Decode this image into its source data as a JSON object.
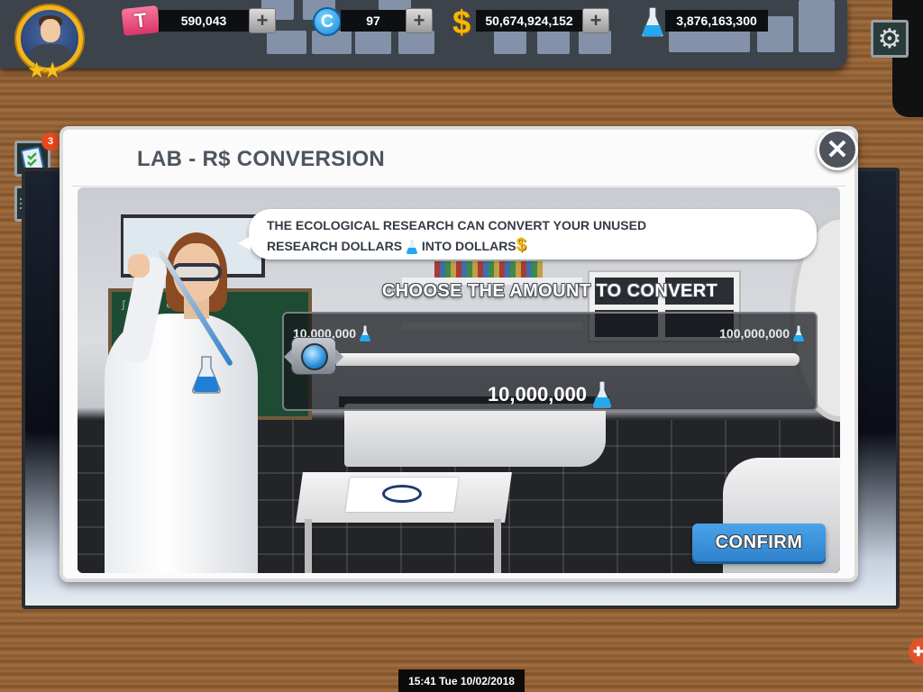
{
  "hud": {
    "player": {
      "stars": 2
    },
    "resources": [
      {
        "name": "tickets",
        "icon": "ticket-icon",
        "value": "590,043",
        "has_plus": true,
        "plus_label": "+"
      },
      {
        "name": "coins",
        "icon": "coin-icon",
        "icon_glyph": "C",
        "value": "97",
        "has_plus": true,
        "plus_label": "+"
      },
      {
        "name": "dollars",
        "icon": "dollar-icon",
        "icon_glyph": "$",
        "value": "50,674,924,152",
        "has_plus": true,
        "plus_label": "+"
      },
      {
        "name": "research_dollars",
        "icon": "flask-icon",
        "value": "3,876,163,300",
        "has_plus": false
      }
    ],
    "settings_icon": "gear-icon",
    "star_glyph": "★★",
    "ticket_glyph": "T",
    "gear_glyph": "⚙"
  },
  "side_buttons": [
    {
      "name": "tasks",
      "icon": "clipboard-icon",
      "badge": "3"
    },
    {
      "name": "exchange",
      "icon": "money-transfer-icon"
    }
  ],
  "modal": {
    "title": "LAB - R$ CONVERSION",
    "close_glyph": "✕",
    "speech": {
      "line1": "THE ECOLOGICAL RESEARCH CAN CONVERT YOUR UNUSED",
      "line2_a": "RESEARCH DOLLARS",
      "line2_b": "INTO DOLLARS",
      "dollar_glyph": "$"
    },
    "converter": {
      "heading": "CHOOSE THE AMOUNT TO CONVERT",
      "min_label": "10,000,000",
      "max_label": "100,000,000",
      "min_value": 10000000,
      "max_value": 100000000,
      "current_value": 10000000,
      "current_label": "10,000,000"
    },
    "confirm_label": "CONFIRM"
  },
  "status_bar": {
    "clock": "15:41 Tue 10/02/2018"
  },
  "corner_button_glyph": "✚",
  "colors": {
    "accent_blue": "#3a92de",
    "badge_orange": "#e8491c",
    "title_gray": "#4d5560",
    "gold": "#f5b60a"
  }
}
